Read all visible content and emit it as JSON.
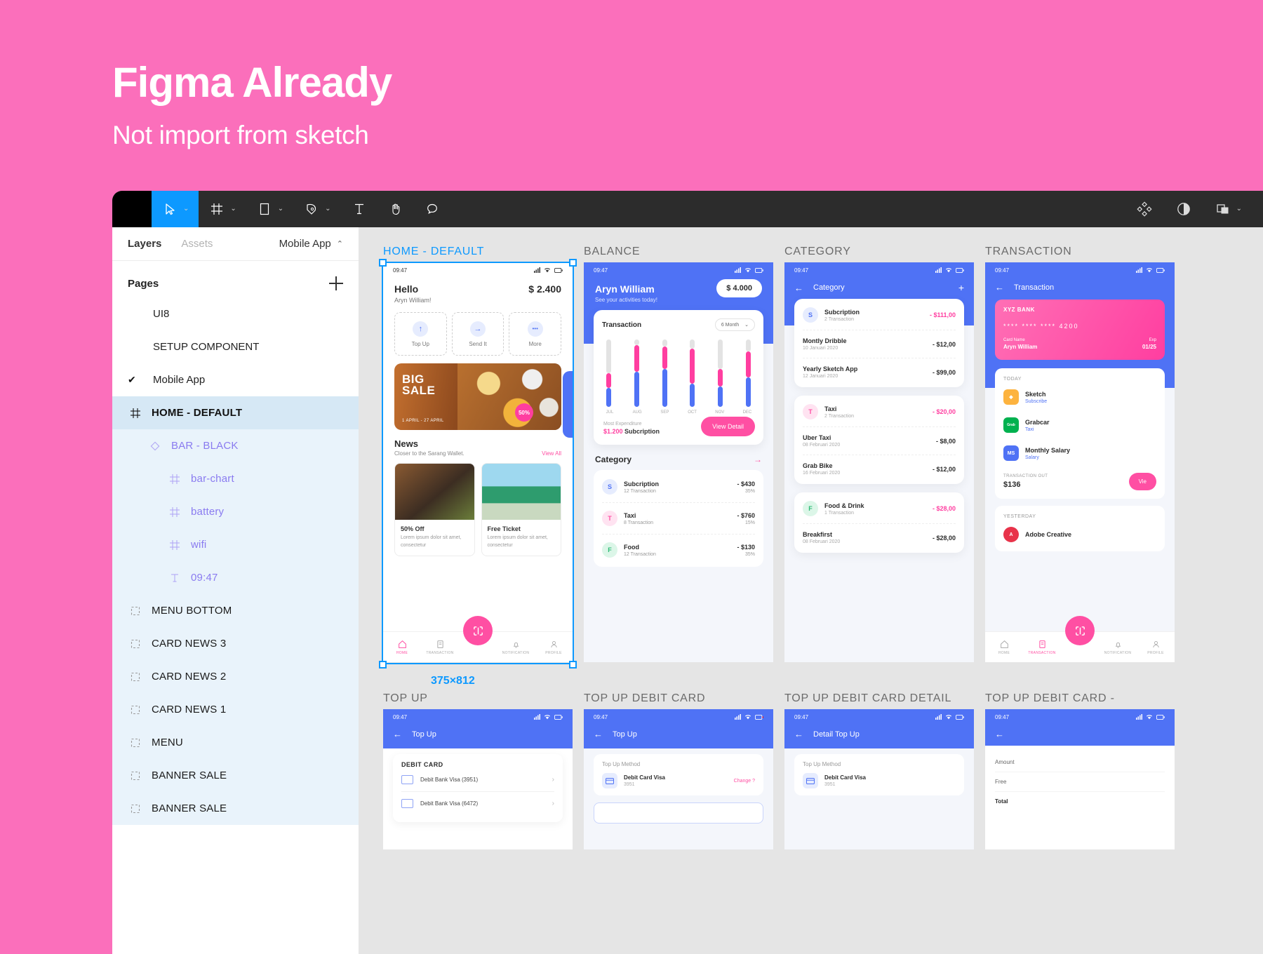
{
  "hero": {
    "title": "Figma Already",
    "subtitle": "Not import from sketch"
  },
  "toolbar": {
    "menu": "menu-icon",
    "tools": [
      {
        "name": "move-tool",
        "icon": "cursor-icon",
        "caret": "⌄",
        "active": true
      },
      {
        "name": "frame-tool",
        "icon": "frame-icon",
        "caret": "⌄",
        "active": false
      },
      {
        "name": "shape-tool",
        "icon": "rectangle-icon",
        "caret": "⌄",
        "active": false
      },
      {
        "name": "pen-tool",
        "icon": "pen-icon",
        "caret": "⌄",
        "active": false
      },
      {
        "name": "text-tool",
        "icon": "text-icon",
        "caret": "",
        "active": false
      },
      {
        "name": "hand-tool",
        "icon": "hand-icon",
        "caret": "",
        "active": false
      },
      {
        "name": "comment-tool",
        "icon": "comment-icon",
        "caret": "",
        "active": false
      }
    ],
    "right": [
      {
        "name": "components-button",
        "icon": "components-icon"
      },
      {
        "name": "mask-button",
        "icon": "contrast-icon"
      },
      {
        "name": "share-button",
        "icon": "layers-icon",
        "caret": "⌄"
      }
    ]
  },
  "panel": {
    "tab_layers": "Layers",
    "tab_assets": "Assets",
    "document": "Mobile App",
    "document_caret": "⌃",
    "pages_title": "Pages",
    "add_page": "+",
    "pages": [
      {
        "name": "UI8",
        "checked": false
      },
      {
        "name": "SETUP COMPONENT",
        "checked": false
      },
      {
        "name": "Mobile App",
        "checked": true,
        "check": "✔"
      }
    ],
    "layers": [
      {
        "label": "HOME - DEFAULT",
        "icon": "frame-icon",
        "level": 1,
        "selected": true
      },
      {
        "label": "BAR - BLACK",
        "icon": "component-icon",
        "level": 2,
        "selected": false
      },
      {
        "label": "bar-chart",
        "icon": "frame-icon",
        "level": 3,
        "selected": false
      },
      {
        "label": "battery",
        "icon": "frame-icon",
        "level": 3,
        "selected": false
      },
      {
        "label": "wifi",
        "icon": "frame-icon",
        "level": 3,
        "selected": false
      },
      {
        "label": "09:47",
        "icon": "text-icon",
        "level": 3,
        "selected": false
      },
      {
        "label": "MENU BOTTOM",
        "icon": "group-icon",
        "level": 1,
        "selected": false
      },
      {
        "label": "CARD NEWS 3",
        "icon": "group-icon",
        "level": 1,
        "selected": false
      },
      {
        "label": "CARD NEWS 2",
        "icon": "group-icon",
        "level": 1,
        "selected": false
      },
      {
        "label": "CARD NEWS 1",
        "icon": "group-icon",
        "level": 1,
        "selected": false
      },
      {
        "label": "MENU",
        "icon": "group-icon",
        "level": 1,
        "selected": false
      },
      {
        "label": "BANNER SALE",
        "icon": "group-icon",
        "level": 1,
        "selected": false
      },
      {
        "label": "BANNER SALE",
        "icon": "group-icon",
        "level": 1,
        "selected": false
      }
    ]
  },
  "canvas": {
    "selection_size": "375×812",
    "frames": [
      {
        "label": "HOME - DEFAULT",
        "selected": true
      },
      {
        "label": "BALANCE",
        "selected": false
      },
      {
        "label": "CATEGORY",
        "selected": false
      },
      {
        "label": "TRANSACTION",
        "selected": false
      },
      {
        "label": "TOP UP",
        "selected": false
      },
      {
        "label": "TOP UP  DEBIT CARD",
        "selected": false
      },
      {
        "label": "TOP UP DEBIT CARD DETAIL",
        "selected": false
      },
      {
        "label": "TOP UP DEBIT CARD -",
        "selected": false
      }
    ]
  },
  "home": {
    "time": "09:47",
    "greeting": "Hello",
    "user": "Aryn William!",
    "balance": "$ 2.400",
    "quick": [
      {
        "label": "Top Up",
        "icon": "arrow-up-icon",
        "glyph": "↑"
      },
      {
        "label": "Send It",
        "icon": "arrow-right-icon",
        "glyph": "→"
      },
      {
        "label": "More",
        "icon": "ellipsis-icon",
        "glyph": "•••"
      }
    ],
    "banner": {
      "line1": "BIG",
      "line2": "SALE",
      "dates": "1 APRIL - 27 APRIL",
      "badge": "50%"
    },
    "news_title": "News",
    "news_sub": "Closer to the Sarang Wallet.",
    "view_all": "View All",
    "news": [
      {
        "title": "50% Off",
        "desc": "Lorem ipsum dolor sit amet, consectetur"
      },
      {
        "title": "Free Ticket",
        "desc": "Lorem ipsum dolor sit amet, consectetur"
      }
    ],
    "tabs": [
      {
        "label": "HOME",
        "icon": "home-icon",
        "active": true
      },
      {
        "label": "TRANSACTION",
        "icon": "document-icon",
        "active": false
      },
      {
        "label": "NOTIFICATION",
        "icon": "bell-icon",
        "active": false
      },
      {
        "label": "PROFILE",
        "icon": "user-icon",
        "active": false
      }
    ],
    "fab": "scan-icon"
  },
  "balance": {
    "time": "09:47",
    "name": "Aryn William",
    "sub": "See your activities today!",
    "chip": "$ 4.000",
    "card_title": "Transaction",
    "period": "6 Month",
    "expenditure_label": "Most Expenditure",
    "expenditure_value": "$1.200",
    "expenditure_name": "Subcription",
    "view_detail": "View Detail",
    "category_title": "Category",
    "chart": {
      "months": [
        "JUL",
        "AUG",
        "SEP",
        "OCT",
        "NOV",
        "DEC"
      ],
      "blue": [
        28,
        52,
        56,
        34,
        30,
        44
      ],
      "pink": [
        22,
        40,
        34,
        52,
        26,
        38
      ]
    },
    "categories": [
      {
        "initial": "S",
        "name": "Subcription",
        "count": "12 Transaction",
        "amount": "- $430",
        "pct": "35%",
        "color": "#E6ECFE",
        "text": "#4F72F5"
      },
      {
        "initial": "T",
        "name": "Taxi",
        "count": "8 Transaction",
        "amount": "- $760",
        "pct": "15%",
        "color": "#FFE3F1",
        "text": "#FF4FA3"
      },
      {
        "initial": "F",
        "name": "Food",
        "count": "12 Transaction",
        "amount": "- $130",
        "pct": "35%",
        "color": "#DCF6E8",
        "text": "#2DBB74"
      }
    ]
  },
  "category": {
    "time": "09:47",
    "title": "Category",
    "back": "←",
    "add": "+",
    "groups": [
      {
        "rows": [
          {
            "initial": "S",
            "name": "Subcription",
            "count": "2 Transaction",
            "amount": "- $111,00",
            "pink": true,
            "color": "#E6ECFE",
            "text": "#4F72F5"
          },
          {
            "name": "Montly Dribble",
            "count": "10 Januari 2020",
            "amount": "- $12,00",
            "pink": false
          },
          {
            "name": "Yearly Sketch App",
            "count": "12 Januari 2020",
            "amount": "- $99,00",
            "pink": false
          }
        ]
      },
      {
        "rows": [
          {
            "initial": "T",
            "name": "Taxi",
            "count": "2 Transaction",
            "amount": "- $20,00",
            "pink": true,
            "color": "#FFE3F1",
            "text": "#FF4FA3"
          },
          {
            "name": "Uber Taxi",
            "count": "08 Februari 2020",
            "amount": "- $8,00",
            "pink": false
          },
          {
            "name": "Grab Bike",
            "count": "16 Februari 2020",
            "amount": "- $12,00",
            "pink": false
          }
        ]
      },
      {
        "rows": [
          {
            "initial": "F",
            "name": "Food & Drink",
            "count": "1 Transaction",
            "amount": "- $28,00",
            "pink": true,
            "color": "#DCF6E8",
            "text": "#2DBB74"
          },
          {
            "name": "Breakfirst",
            "count": "08 Februari 2020",
            "amount": "- $28,00",
            "pink": false
          }
        ]
      }
    ]
  },
  "transaction": {
    "time": "09:47",
    "title": "Transaction",
    "back": "←",
    "card": {
      "bank": "XYZ BANK",
      "number": "**** **** **** 4200",
      "name_label": "Card Name",
      "name": "Aryn William",
      "exp_label": "Exp",
      "exp": "01/25"
    },
    "today_label": "TODAY",
    "yesterday_label": "YESTERDAY",
    "today": [
      {
        "name": "Sketch",
        "sub": "Subscribe",
        "icon": "sketch-icon",
        "color": "#FDB33F"
      },
      {
        "name": "Grabcar",
        "sub": "Taxi",
        "icon": "grab-icon",
        "color": "#00B14F"
      },
      {
        "name": "Monthly Salary",
        "sub": "Salary",
        "icon": "ms-icon",
        "color": "#4F72F5"
      }
    ],
    "yesterday": [
      {
        "name": "Adobe Creative",
        "sub": "",
        "icon": "adobe-icon",
        "color": "#E8334A"
      }
    ],
    "out_label": "TRANSACTION OUT",
    "out_value": "$136",
    "out_button": "Vie",
    "tabs": [
      {
        "label": "HOME",
        "icon": "home-icon",
        "active": false
      },
      {
        "label": "TRANSACTION",
        "icon": "document-icon",
        "active": true
      },
      {
        "label": "NOTIFICATION",
        "icon": "bell-icon",
        "active": false
      },
      {
        "label": "PROFILE",
        "icon": "user-icon",
        "active": false
      }
    ]
  },
  "topup": {
    "time": "09:47",
    "title": "Top Up",
    "back": "←",
    "card_header": "DEBIT CARD",
    "rows": [
      {
        "name": "Debit Bank Visa (3951)",
        "chev": "›"
      },
      {
        "name": "Debit Bank Visa (6472)",
        "chev": "›"
      }
    ]
  },
  "topup_debit": {
    "time": "09:47",
    "title": "Top Up",
    "back": "←",
    "method_label": "Top Up Method",
    "method_name": "Debit Card Visa",
    "method_sub": "3951",
    "change": "Change ?"
  },
  "topup_detail": {
    "time": "09:47",
    "title": "Detail Top Up",
    "back": "←",
    "method_label": "Top Up Method",
    "method_name": "Debit Card Visa",
    "method_sub": "3951"
  },
  "topup_last": {
    "time": "09:47",
    "back": "←",
    "amount_label": "Amount",
    "free_label": "Free",
    "total_label": "Total"
  },
  "colors": {
    "brand_pink": "#FB6FBB",
    "accent_pink": "#FF4FA3",
    "figma_blue": "#0D99FF",
    "app_blue": "#4F72F5",
    "toolbar": "#2C2C2C",
    "canvas": "#E5E5E5"
  }
}
